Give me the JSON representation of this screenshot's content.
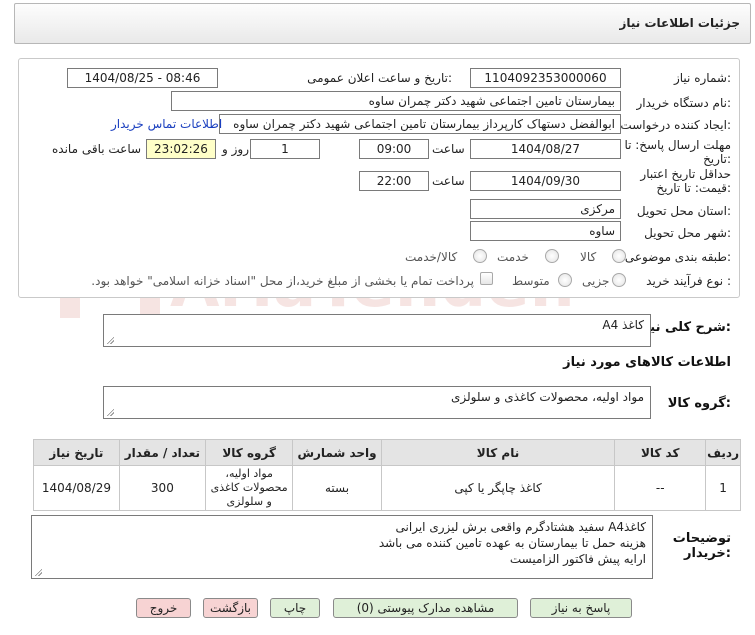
{
  "header": {
    "title": "جزئیات اطلاعات نیاز"
  },
  "watermark": {
    "text": "AriaTender.neT"
  },
  "form": {
    "need_number_label": "شماره نیاز:",
    "need_number": "1104092353000060",
    "announce_label": "تاریخ و ساعت اعلان عمومی:",
    "announce_value": "1404/08/25 - 08:46",
    "buyer_label": "نام دستگاه خریدار:",
    "buyer_value": "بیمارستان تامین اجتماعی شهید دکتر چمران ساوه",
    "creator_label": "ایجاد کننده درخواست:",
    "creator_value": "ابوالفضل  دستهاک  کارپرداز بیمارستان تامین اجتماعی شهید دکتر چمران ساوه",
    "contact_link": "اطلاعات تماس خریدار",
    "deadline_label_1": "مهلت ارسال پاسخ: تا",
    "deadline_label_2": "تاریخ:",
    "deadline_date": "1404/08/27",
    "time_label": "ساعت",
    "deadline_time": "09:00",
    "days_value": "1",
    "days_label": "روز و",
    "remaining_time": "23:02:26",
    "remaining_label": "ساعت باقی مانده",
    "validity_label_1": "حداقل تاریخ اعتبار",
    "validity_label_2": "قیمت: تا تاریخ:",
    "validity_date": "1404/09/30",
    "validity_time": "22:00",
    "province_label": "استان محل تحویل:",
    "province_value": "مرکزی",
    "city_label": "شهر محل تحویل:",
    "city_value": "ساوه",
    "category_label": "طبقه بندی موضوعی:",
    "category_options": [
      "کالا",
      "خدمت",
      "کالا/خدمت"
    ],
    "process_label": "نوع فرآیند خرید :",
    "process_options": [
      "جزیی",
      "متوسط"
    ],
    "payment_note": "پرداخت تمام یا بخشی از مبلغ خرید،از محل \"اسناد خزانه اسلامی\" خواهد بود."
  },
  "summary": {
    "label": "شرح کلی نیاز:",
    "value": "کاغذ A4"
  },
  "goods_info": {
    "title": "اطلاعات کالاهای مورد نیاز",
    "group_label": "گروه کالا:",
    "group_value": "مواد اولیه، محصولات کاغذی و سلولزی"
  },
  "table": {
    "headers": [
      "ردیف",
      "کد کالا",
      "نام کالا",
      "واحد شمارش",
      "گروه کالا",
      "تعداد / مقدار",
      "تاریخ نیاز"
    ],
    "rows": [
      [
        "1",
        "--",
        "کاغذ چاپگر یا کپی",
        "بسته",
        "مواد اولیه، محصولات کاغذی و سلولزی",
        "300",
        "1404/08/29"
      ]
    ]
  },
  "notes": {
    "label_1": "توضیحات",
    "label_2": "خریدار:",
    "lines": [
      "کاغذA4 سفید هشتادگرم واقعی برش لیزری ایرانی",
      "هزینه حمل تا بیمارستان به عهده تامین کننده می باشد",
      "ارایه پیش فاکتور الزامیست"
    ]
  },
  "buttons": {
    "reply": "پاسخ به نیاز",
    "attachments": "مشاهده مدارک پیوستی (0)",
    "print": "چاپ",
    "back": "بازگشت",
    "exit": "خروج"
  }
}
